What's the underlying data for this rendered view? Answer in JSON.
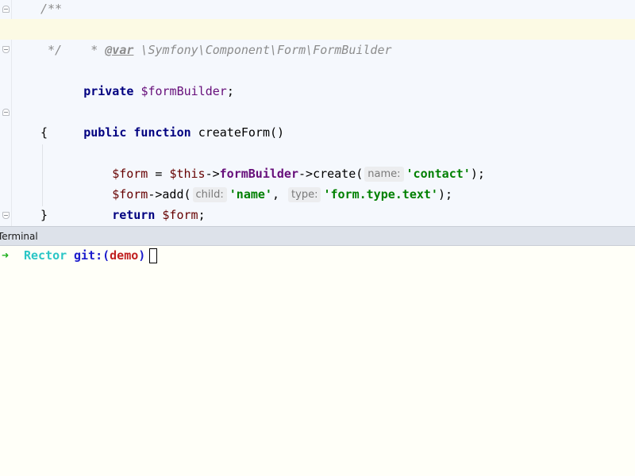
{
  "editor": {
    "lines": {
      "doc_open": "/**",
      "doc_star": " *",
      "doc_tag": "@var",
      "doc_type": " \\Symfony\\Component\\Form\\FormBuilder",
      "doc_close": " */",
      "prop_kw": "private",
      "prop_var": "$formBuilder",
      "prop_semi": ";",
      "method_kw1": "public",
      "method_kw2": "function",
      "method_name": "createForm",
      "method_parens": "()",
      "brace_open": "{",
      "l1_var": "$form",
      "l1_eq": " = ",
      "l1_this": "$this",
      "l1_arrow1": "->",
      "l1_field": "formBuilder",
      "l1_arrow2": "->",
      "l1_call": "create(",
      "l1_hint": "name:",
      "l1_arg": "'contact'",
      "l1_end": ");",
      "l2_var": "$form",
      "l2_arrow": "->",
      "l2_call": "add(",
      "l2_hint1": "child:",
      "l2_arg1": "'name'",
      "l2_comma": ", ",
      "l2_hint2": "type:",
      "l2_arg2": "'form.type.text'",
      "l2_end": ");",
      "l3_kw": "return",
      "l3_var": " $form",
      "l3_end": ";",
      "brace_close": "}"
    }
  },
  "terminal": {
    "title": "Terminal",
    "prompt_arrow": "➜",
    "prompt_dir": "Rector",
    "prompt_git": "git:",
    "prompt_paren_open": "(",
    "prompt_branch": "demo",
    "prompt_paren_close": ")"
  },
  "colors": {
    "editor_bg": "#f5f8fd",
    "highlight_line": "#fcfae4",
    "keyword": "#000080",
    "string": "#008000",
    "terminal_bg": "#fffff8"
  }
}
